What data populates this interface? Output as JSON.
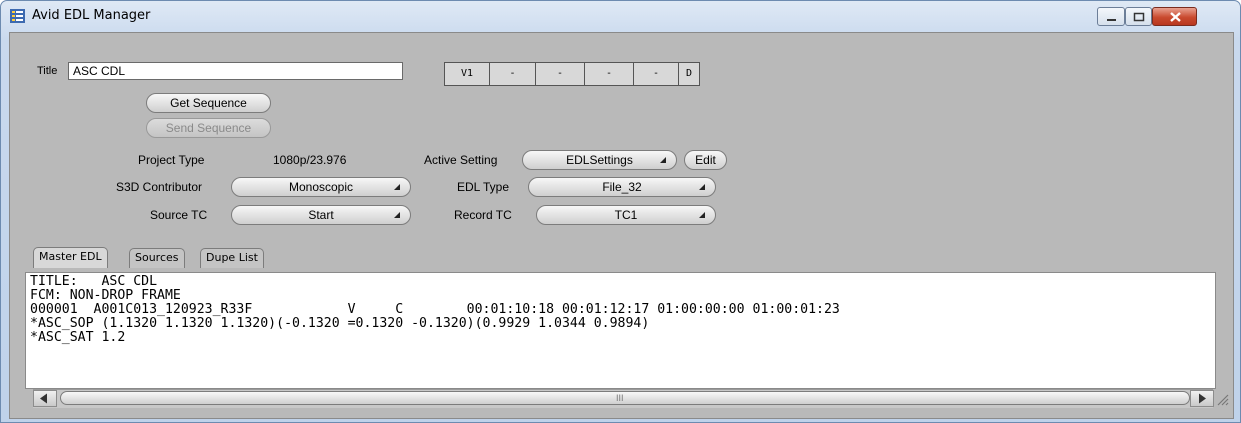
{
  "window": {
    "title": "Avid EDL Manager",
    "icon": "edl-list-icon",
    "controls": [
      "minimize-icon",
      "maximize-icon",
      "close-icon"
    ]
  },
  "form": {
    "title_label": "Title",
    "title_value": "ASC CDL",
    "get_sequence_label": "Get Sequence",
    "send_sequence_label": "Send Sequence",
    "project_type_label": "Project Type",
    "project_type_value": "1080p/23.976",
    "active_setting_label": "Active Setting",
    "active_setting_value": "EDLSettings",
    "edit_label": "Edit",
    "s3d_label": "S3D Contributor",
    "s3d_value": "Monoscopic",
    "edl_type_label": "EDL Type",
    "edl_type_value": "File_32",
    "source_tc_label": "Source TC",
    "source_tc_value": "Start",
    "record_tc_label": "Record TC",
    "record_tc_value": "TC1"
  },
  "tracks": [
    "V1",
    "-",
    "-",
    "-",
    "-",
    "D"
  ],
  "tabs": [
    {
      "label": "Master EDL",
      "active": true
    },
    {
      "label": "Sources",
      "active": false
    },
    {
      "label": "Dupe List",
      "active": false
    }
  ],
  "edl_lines": [
    "TITLE:   ASC CDL",
    "FCM: NON-DROP FRAME",
    "000001  A001C013_120923_R33F            V     C        00:01:10:18 00:01:12:17 01:00:00:00 01:00:01:23",
    "*ASC_SOP (1.1320 1.1320 1.1320)(-0.1320 =0.1320 -0.1320)(0.9929 1.0344 0.9894)",
    "*ASC_SAT 1.2"
  ],
  "scrollbar": {
    "thumb_grip": "III"
  },
  "colors": {
    "client_bg": "#b9b9b9",
    "close_button": "#c94a2f",
    "frame": "#bfd2ea"
  }
}
